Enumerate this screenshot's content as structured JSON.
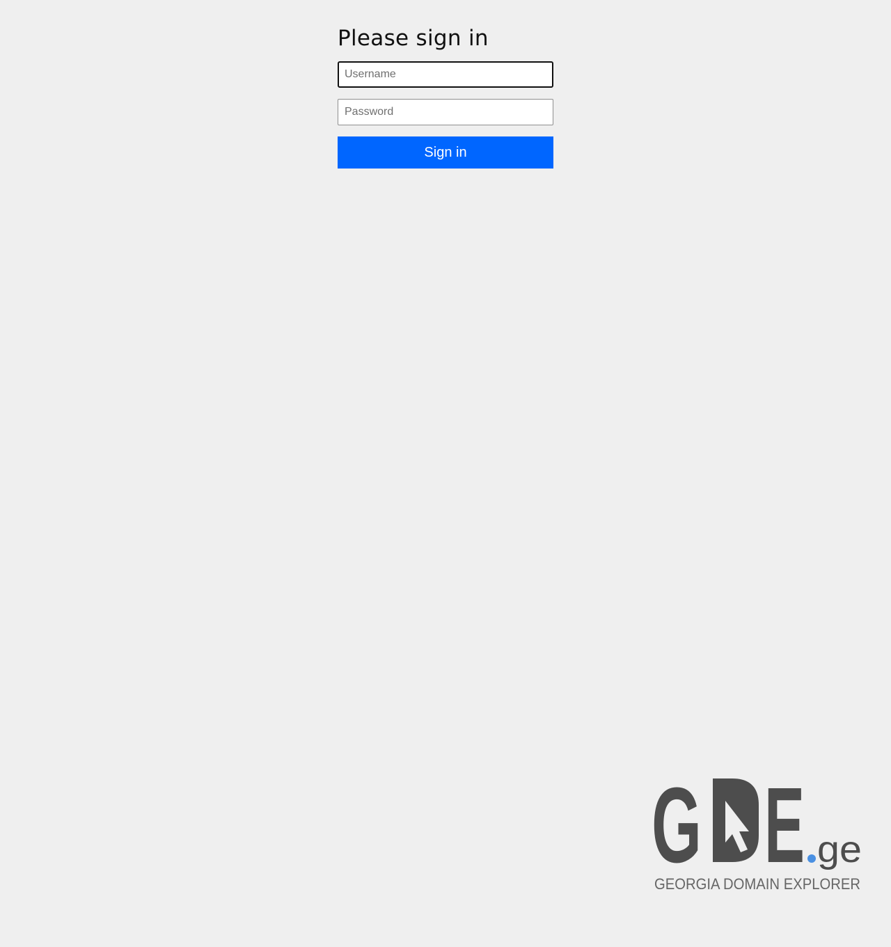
{
  "form": {
    "title": "Please sign in",
    "username_placeholder": "Username",
    "password_placeholder": "Password",
    "submit_label": "Sign in"
  },
  "logo": {
    "mark_g": "G",
    "mark_e": "E",
    "tld": "ge",
    "tagline": "GEORGIA DOMAIN EXPLORER"
  },
  "colors": {
    "background": "#efefef",
    "button": "#0066ff",
    "logo_gray": "#4d4d4d",
    "logo_dot": "#4a90e2"
  }
}
